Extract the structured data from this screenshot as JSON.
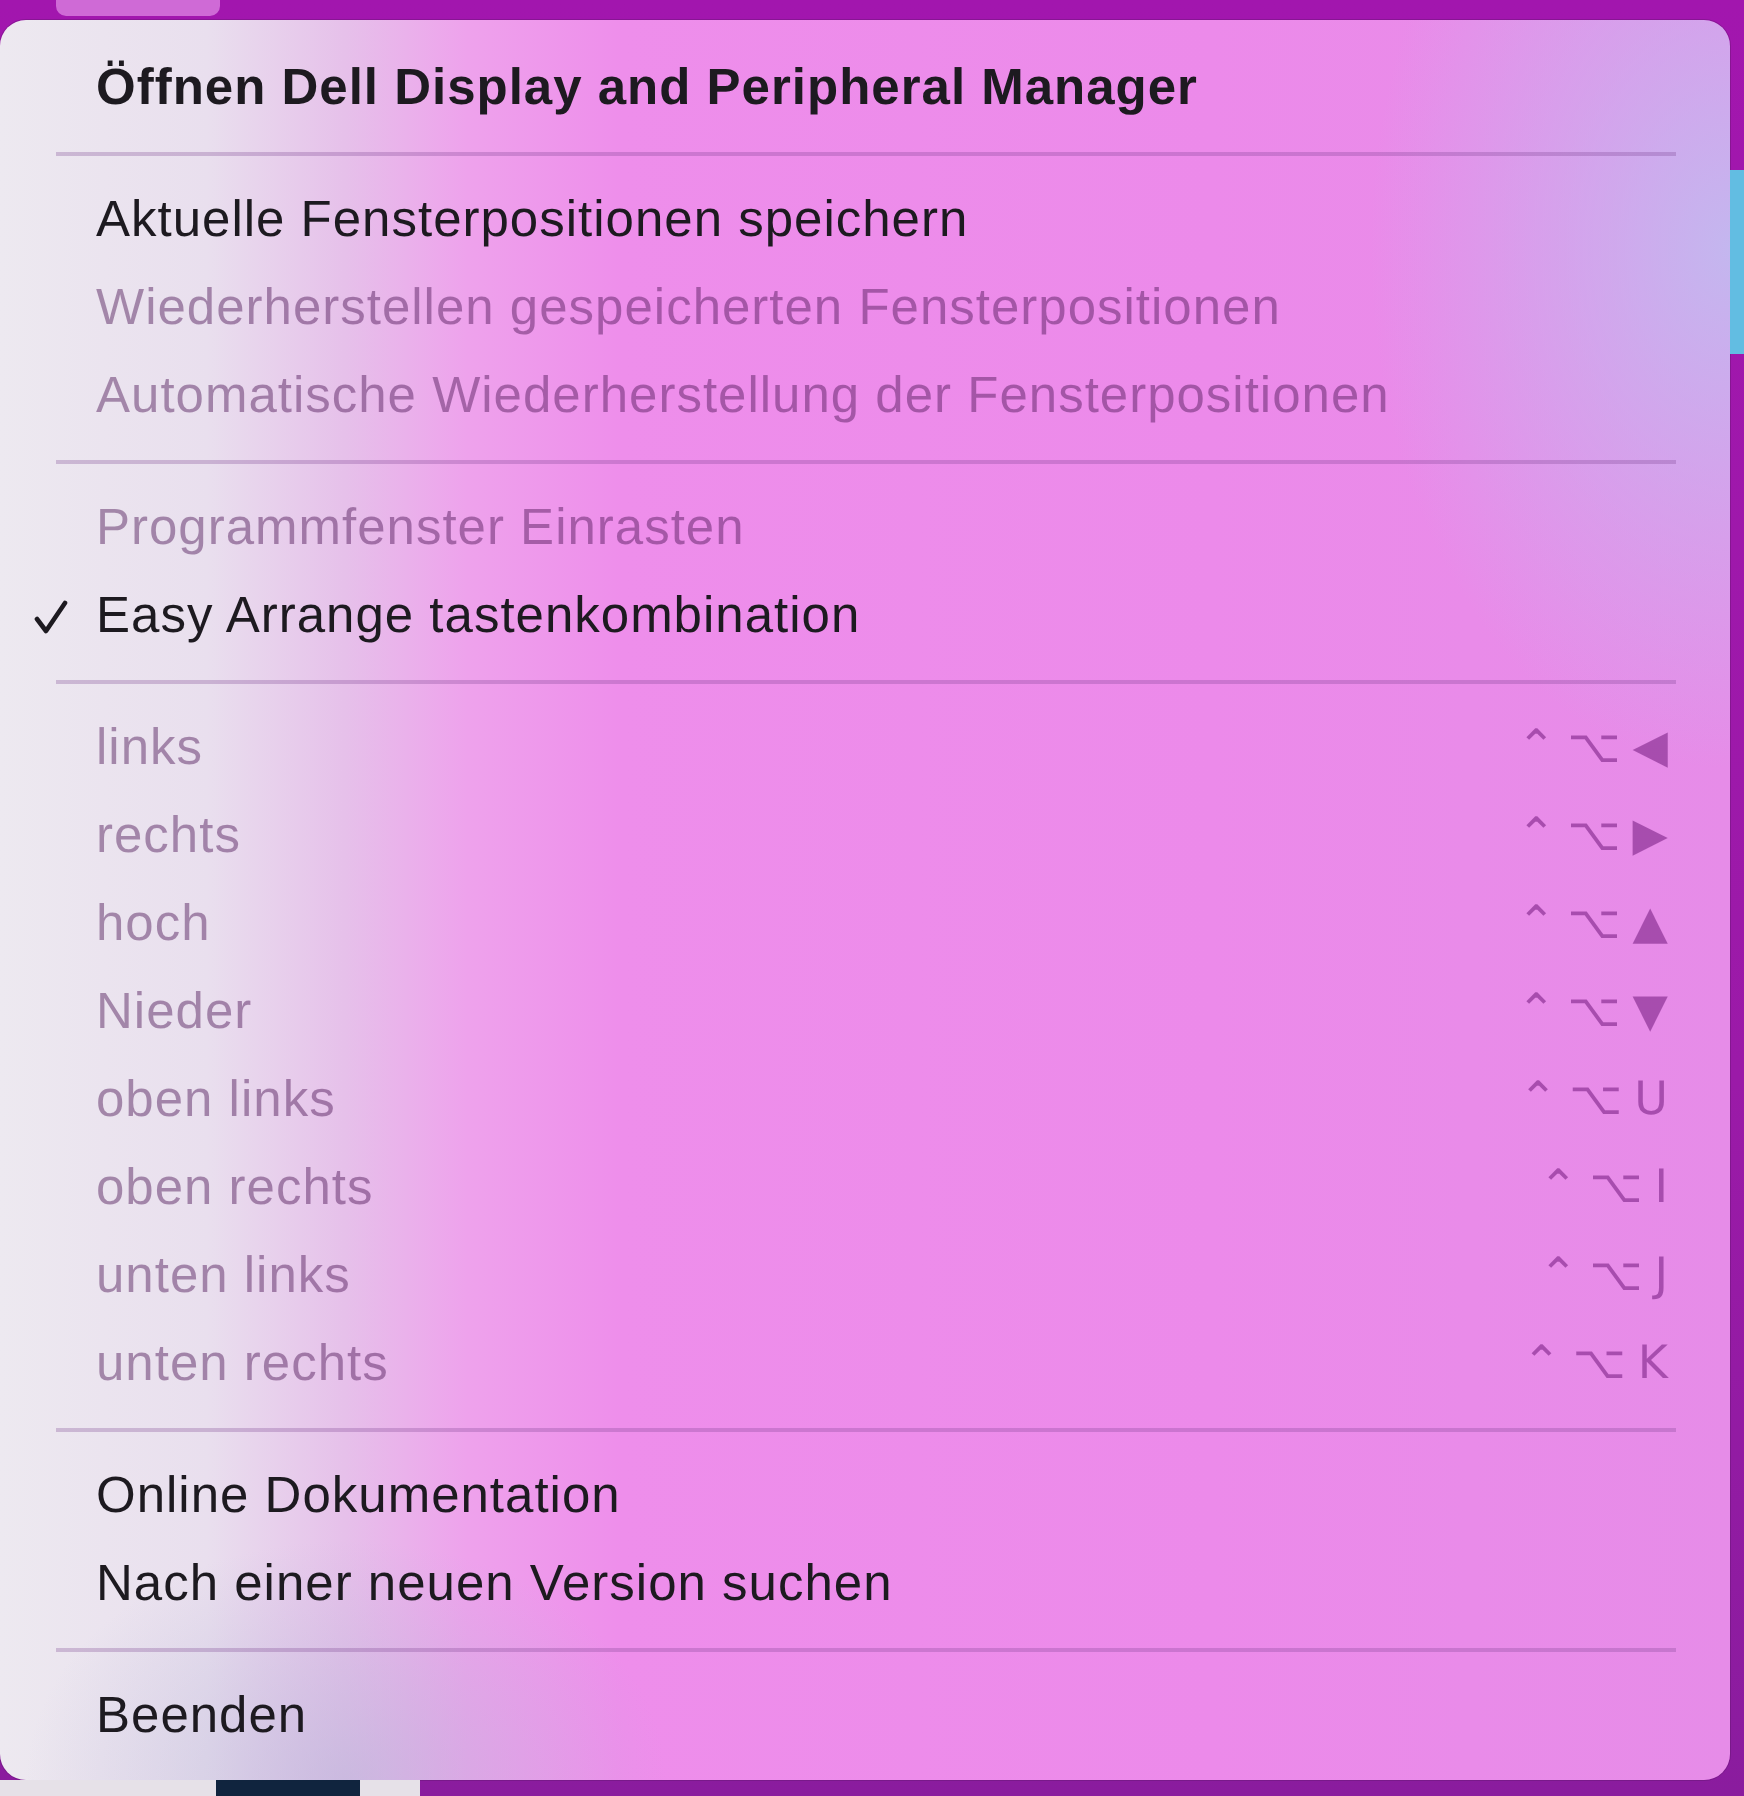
{
  "menu": {
    "sections": [
      {
        "items": [
          {
            "kind": "title",
            "label": "Öffnen Dell Display and Peripheral Manager",
            "disabled": false,
            "checked": false
          }
        ]
      },
      {
        "items": [
          {
            "kind": "item",
            "label": "Aktuelle Fensterpositionen speichern",
            "disabled": false,
            "checked": false
          },
          {
            "kind": "item",
            "label": "Wiederherstellen gespeicherten Fensterpositionen",
            "disabled": true,
            "checked": false
          },
          {
            "kind": "item",
            "label": "Automatische Wiederherstellung der Fensterpositionen",
            "disabled": true,
            "checked": false
          }
        ]
      },
      {
        "items": [
          {
            "kind": "item",
            "label": "Programmfenster Einrasten",
            "disabled": true,
            "checked": false
          },
          {
            "kind": "item",
            "label": "Easy Arrange tastenkombination",
            "disabled": false,
            "checked": true
          }
        ]
      },
      {
        "items": [
          {
            "kind": "item",
            "label": "links",
            "shortcut": "⌃⌥◀",
            "disabled": true,
            "checked": false
          },
          {
            "kind": "item",
            "label": "rechts",
            "shortcut": "⌃⌥▶",
            "disabled": true,
            "checked": false
          },
          {
            "kind": "item",
            "label": "hoch",
            "shortcut": "⌃⌥▲",
            "disabled": true,
            "checked": false
          },
          {
            "kind": "item",
            "label": "Nieder",
            "shortcut": "⌃⌥▼",
            "disabled": true,
            "checked": false
          },
          {
            "kind": "item",
            "label": "oben links",
            "shortcut": "⌃⌥U",
            "disabled": true,
            "checked": false
          },
          {
            "kind": "item",
            "label": "oben rechts",
            "shortcut": "⌃⌥I",
            "disabled": true,
            "checked": false
          },
          {
            "kind": "item",
            "label": "unten links",
            "shortcut": "⌃⌥J",
            "disabled": true,
            "checked": false
          },
          {
            "kind": "item",
            "label": "unten rechts",
            "shortcut": "⌃⌥K",
            "disabled": true,
            "checked": false
          }
        ]
      },
      {
        "items": [
          {
            "kind": "item",
            "label": "Online Dokumentation",
            "disabled": false,
            "checked": false
          },
          {
            "kind": "item",
            "label": "Nach einer neuen Version suchen",
            "disabled": false,
            "checked": false
          }
        ]
      },
      {
        "items": [
          {
            "kind": "item",
            "label": "Beenden",
            "disabled": false,
            "checked": false
          }
        ]
      }
    ]
  }
}
